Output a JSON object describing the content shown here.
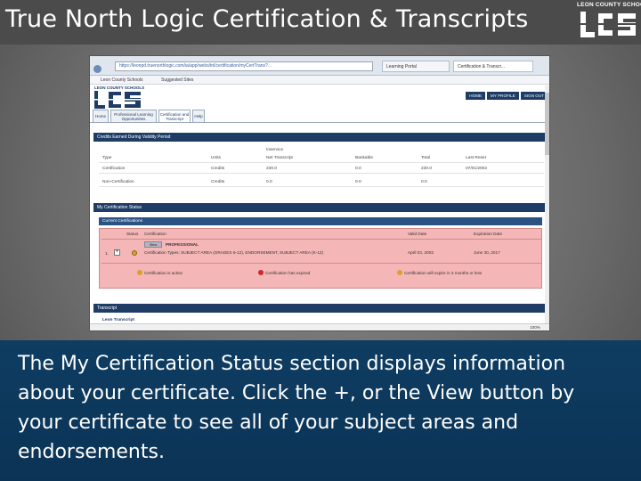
{
  "slide": {
    "title": "True North Logic Certification & Transcripts",
    "logo_text": "LEON COUNTY SCHOOLS",
    "caption": "The My Certification Status section displays information about your certificate. Click the +, or the View button by your certificate to see all of your subject areas and endorsements."
  },
  "browser": {
    "address": "https://leonpd.truenorthlogic.com/ia/app/webs/tnl/certification/myCertTrans?...",
    "tabs": [
      "Learning Portal",
      "Certification & Transcr..."
    ],
    "favorites": [
      "Leon County Schools",
      "Suggested Sites"
    ],
    "top_links": [
      "HOME",
      "MY PROFILE",
      "SIGN OUT"
    ],
    "site_logo_caption": "LEON COUNTY SCHOOLS",
    "nav_tabs": [
      "Home",
      "Professional Learning Opportunities",
      "Certification and Transcript",
      "Help"
    ],
    "credits_header": "Credits Earned During Validity Period",
    "credits_group": "Inservice",
    "credits_columns": [
      "Type",
      "Units",
      "Net Transcript",
      "Bankable",
      "Total",
      "Last Reset"
    ],
    "credits_rows": [
      [
        "Certification",
        "Credits",
        "230.0",
        "0.0",
        "230.0",
        "07/01/2002"
      ],
      [
        "Non-Certification",
        "Credits",
        "0.0",
        "0.0",
        "0.0",
        ""
      ]
    ],
    "my_cert_header": "My Certification Status",
    "current_cert_header": "Current Certifications",
    "cert_columns": [
      "Status",
      "Certification",
      "Valid Date",
      "Expiration Date"
    ],
    "cert_row": {
      "num": "1.",
      "view_label": "View",
      "name": "PROFESSIONAL",
      "details": "Certification Types: SUBJECT AREA (GRADES 6-12), ENDORSEMENT, SUBJECT AREA (K-12)",
      "valid": "April 03, 2002",
      "expires": "June 30, 2017"
    },
    "legend": [
      "Certification is active",
      "Certification has expired",
      "Certification will expire in 3 months or less"
    ],
    "transcript_header": "Transcript",
    "transcript_sub": "Leon Transcript",
    "zoom": "100%"
  },
  "colors": {
    "title_bar": "#4b4b4b",
    "caption_band": "#0e3d62",
    "nav_dark": "#1f3c66",
    "status_pink": "#f4b6b6"
  }
}
